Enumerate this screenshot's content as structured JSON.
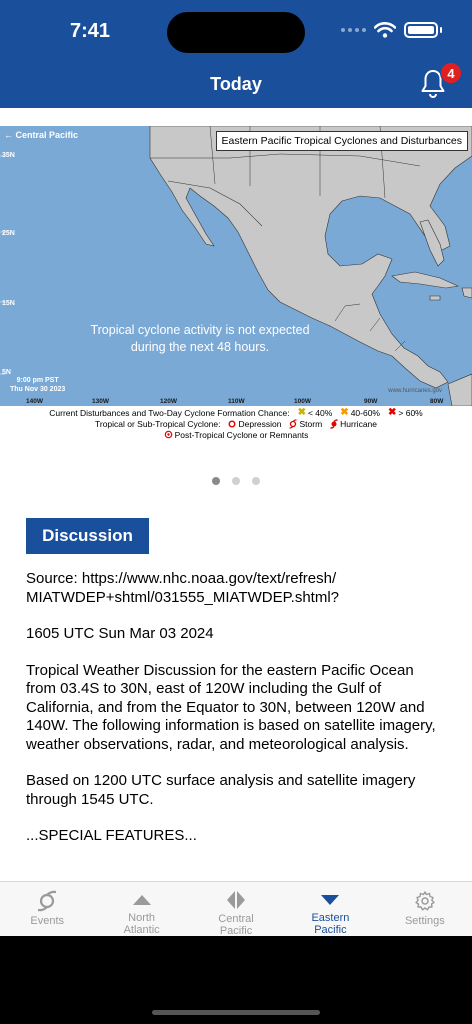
{
  "status_bar": {
    "time": "7:41"
  },
  "header": {
    "title": "Today",
    "notification_count": "4"
  },
  "map": {
    "region_link": "← Central Pacific",
    "title": "Eastern Pacific Tropical Cyclones and Disturbances",
    "latitudes": [
      "35N",
      "25N",
      "15N",
      "5N"
    ],
    "longitudes": [
      "140W",
      "130W",
      "120W",
      "110W",
      "100W",
      "90W",
      "80W"
    ],
    "message_line1": "Tropical cyclone activity is not expected",
    "message_line2": "during the next 48 hours.",
    "time_line1": "9:00 pm PST",
    "time_line2": "Thu Nov 30 2023",
    "site": "www.hurricanes.gov",
    "colors": {
      "ocean": "#7aa9d6",
      "land": "#c8c8c8",
      "border": "#333333"
    }
  },
  "legend": {
    "row1_label": "Current Disturbances and Two-Day Cyclone Formation Chance:",
    "low": "< 40%",
    "medium": "40-60%",
    "high": "> 60%",
    "row2_label": "Tropical or Sub-Tropical Cyclone:",
    "depression": "Depression",
    "storm": "Storm",
    "hurricane": "Hurricane",
    "row3_label": "Post-Tropical Cyclone or Remnants",
    "colors": {
      "low": "#f2e500",
      "medium": "#f29a00",
      "high": "#e00000"
    }
  },
  "pager": {
    "total": 3,
    "active": 0
  },
  "discussion": {
    "button_label": "Discussion",
    "paragraphs": [
      "Source: https://www.nhc.noaa.gov/text/refresh/\nMIATWDEP+shtml/031555_MIATWDEP.shtml?",
      "1605 UTC Sun Mar 03 2024",
      "Tropical Weather Discussion for the eastern Pacific Ocean from 03.4S to 30N, east of 120W including the Gulf of California, and from the Equator to 30N, between 120W and 140W. The following information is based on satellite imagery, weather observations, radar, and meteorological analysis.",
      "Based on 1200 UTC surface analysis and satellite imagery through 1545 UTC.",
      "...SPECIAL FEATURES..."
    ]
  },
  "tabs": [
    {
      "label": "Events",
      "icon": "hurricane-symbol-icon",
      "active": false
    },
    {
      "label": "North\nAtlantic",
      "icon": "triangle-up-icon",
      "active": false
    },
    {
      "label": "Central\nPacific",
      "icon": "diamond-split-icon",
      "active": false
    },
    {
      "label": "Eastern\nPacific",
      "icon": "triangle-down-icon",
      "active": true
    },
    {
      "label": "Settings",
      "icon": "gear-icon",
      "active": false
    }
  ],
  "theme": {
    "primary": "#1a4f9c",
    "inactive": "#9a9a9a",
    "badge": "#e02020"
  }
}
